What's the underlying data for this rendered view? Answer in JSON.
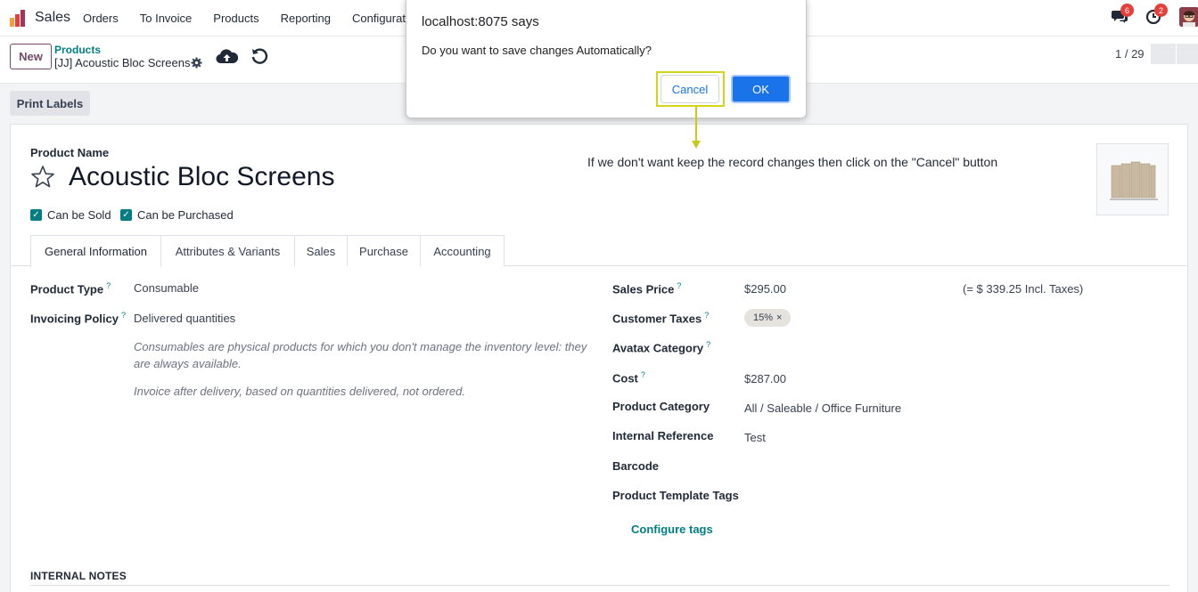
{
  "nav": {
    "app_name": "Sales",
    "menu": [
      "Orders",
      "To Invoice",
      "Products",
      "Reporting",
      "Configuration"
    ],
    "messages_count": "6",
    "activities_count": "2"
  },
  "control": {
    "new_label": "New",
    "breadcrumb_parent": "Products",
    "breadcrumb_current": "[JJ] Acoustic Bloc Screens",
    "pager": "1 / 29"
  },
  "status": {
    "print_labels": "Print Labels"
  },
  "form": {
    "product_name_label": "Product Name",
    "product_name": "Acoustic Bloc Screens",
    "can_be_sold": "Can be Sold",
    "can_be_purchased": "Can be Purchased",
    "tabs": [
      "General Information",
      "Attributes & Variants",
      "Sales",
      "Purchase",
      "Accounting"
    ],
    "left": {
      "product_type_label": "Product Type",
      "product_type": "Consumable",
      "invoicing_policy_label": "Invoicing Policy",
      "invoicing_policy": "Delivered quantities",
      "help1": "Consumables are physical products for which you don't manage the inventory level: they are always available.",
      "help2": "Invoice after delivery, based on quantities delivered, not ordered."
    },
    "right": {
      "sales_price_label": "Sales Price",
      "sales_price": "$295.00",
      "incl_taxes": "(= $ 339.25 Incl. Taxes)",
      "customer_taxes_label": "Customer Taxes",
      "tax_tag": "15%",
      "avatax_label": "Avatax Category",
      "cost_label": "Cost",
      "cost": "$287.00",
      "category_label": "Product Category",
      "category": "All / Saleable / Office Furniture",
      "internal_ref_label": "Internal Reference",
      "internal_ref": "Test",
      "barcode_label": "Barcode",
      "template_tags_label": "Product Template Tags",
      "configure_tags": "Configure tags"
    },
    "internal_notes": "INTERNAL NOTES"
  },
  "dialog": {
    "title": "localhost:8075 says",
    "message": "Do you want to save changes Automatically?",
    "cancel": "Cancel",
    "ok": "OK"
  },
  "annotation": "If we don't want keep the record changes then click on the \"Cancel\" button",
  "colors": {
    "accent": "#017e84",
    "brand": "#714b67",
    "dialog_blue": "#1a73e8",
    "highlight": "#d4d41a"
  }
}
